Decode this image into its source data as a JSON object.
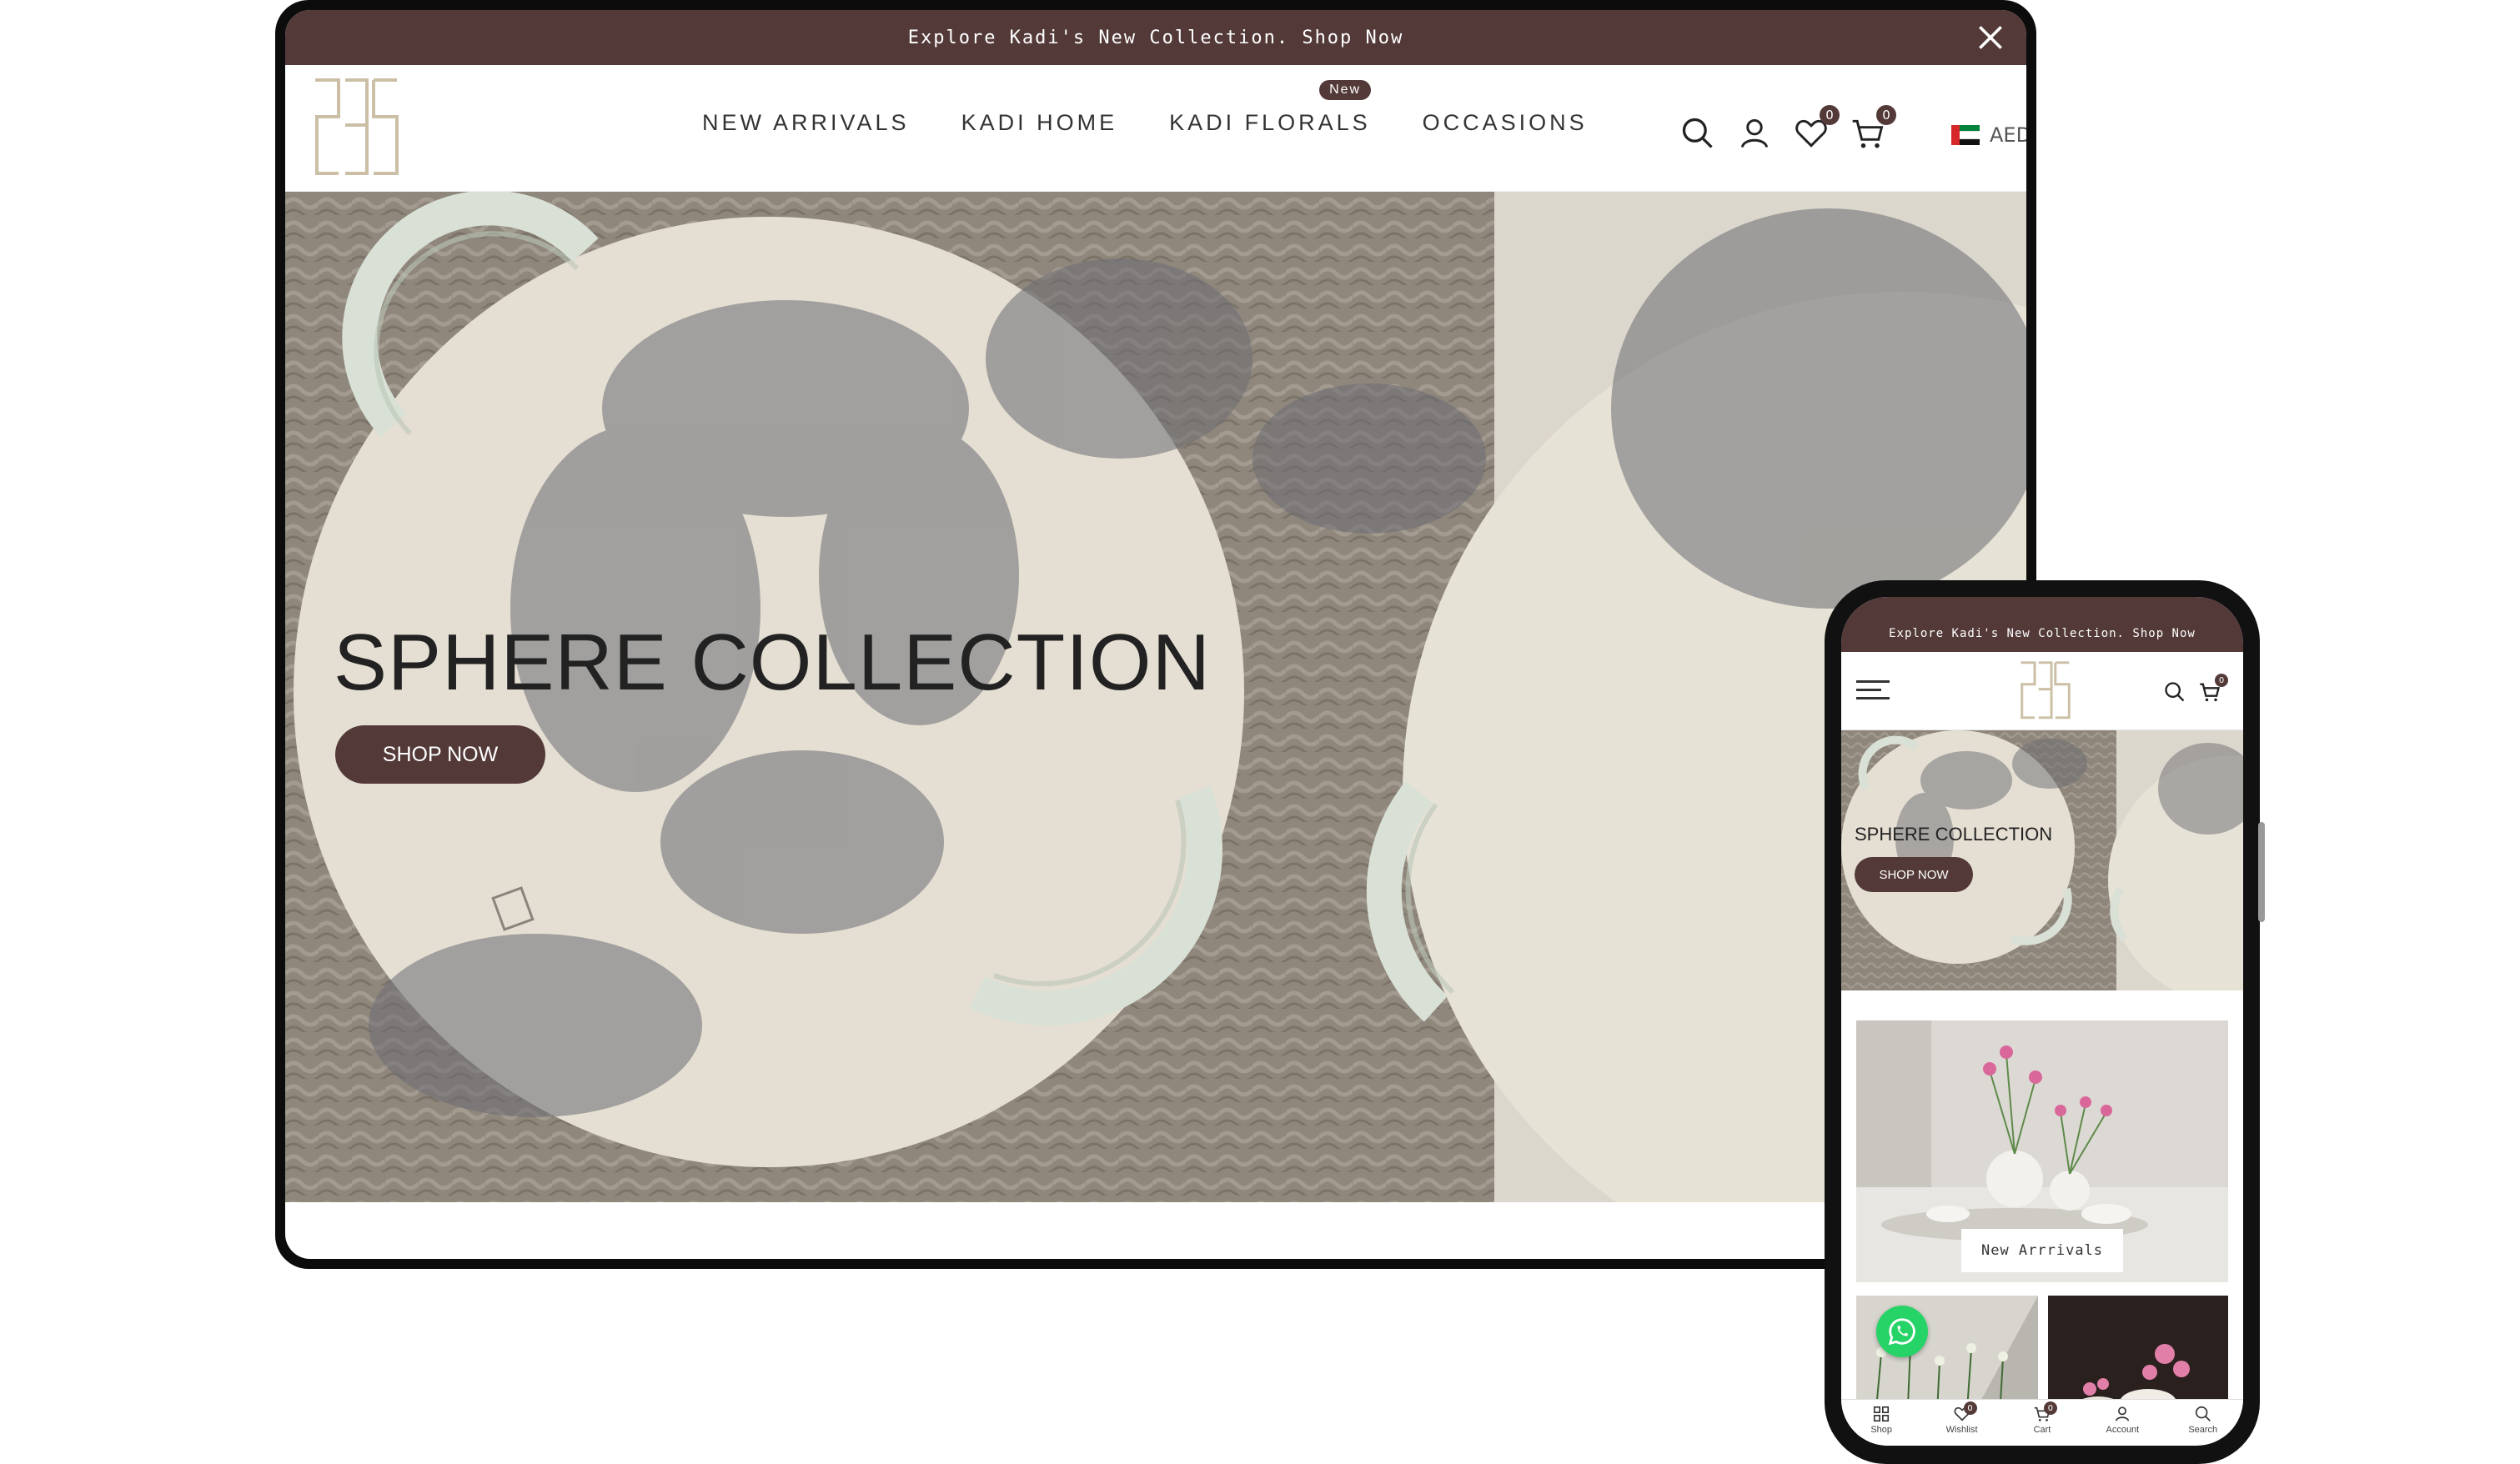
{
  "colors": {
    "brand": "#533a39",
    "whatsapp": "#25d366"
  },
  "desktop": {
    "announcement": "Explore Kadi's New Collection. Shop Now",
    "nav": [
      {
        "label": "NEW ARRIVALS"
      },
      {
        "label": "KADI HOME"
      },
      {
        "label": "KADI FLORALS",
        "badge": "New"
      },
      {
        "label": "OCCASIONS"
      }
    ],
    "header_icons": [
      "search-icon",
      "account-icon",
      "wishlist-icon",
      "cart-icon"
    ],
    "wishlist_count": "0",
    "cart_count": "0",
    "currency": "AED",
    "hero": {
      "title": "SPHERE COLLECTION",
      "button": "SHOP NOW"
    }
  },
  "mobile": {
    "announcement": "Explore Kadi's New Collection. Shop Now",
    "cart_count": "0",
    "hero": {
      "title": "SPHERE COLLECTION",
      "button": "SHOP NOW"
    },
    "card_label": "New Arrrivals",
    "bottom_nav": [
      {
        "label": "Shop",
        "icon": "grid-icon"
      },
      {
        "label": "Wishlist",
        "icon": "heart-icon",
        "count": "0"
      },
      {
        "label": "Cart",
        "icon": "cart-icon",
        "count": "0"
      },
      {
        "label": "Account",
        "icon": "account-icon"
      },
      {
        "label": "Search",
        "icon": "search-icon"
      }
    ]
  }
}
